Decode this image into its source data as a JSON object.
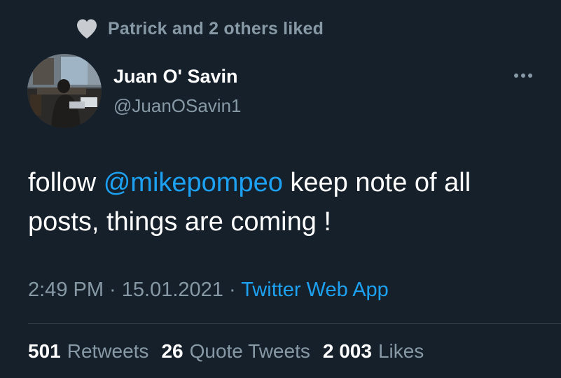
{
  "social_context": {
    "icon": "heart-icon",
    "text": "Patrick and 2 others liked"
  },
  "author": {
    "display_name": "Juan O' Savin",
    "handle": "@JuanOSavin1"
  },
  "menu": {
    "icon": "more-icon"
  },
  "tweet": {
    "text_before": "follow ",
    "mention": "@mikepompeo",
    "text_after": " keep note of all posts, things are coming !"
  },
  "meta": {
    "time": "2:49 PM",
    "sep1": " · ",
    "date": "15.01.2021",
    "sep2": " · ",
    "source": "Twitter Web App"
  },
  "stats": {
    "retweets_count": "501",
    "retweets_label": "Retweets",
    "quotes_count": "26",
    "quotes_label": "Quote Tweets",
    "likes_count": "2 003",
    "likes_label": "Likes"
  },
  "colors": {
    "background": "#15202b",
    "text_primary": "#ffffff",
    "text_secondary": "#8899a6",
    "accent": "#1da1f2",
    "divider": "#38444d"
  }
}
